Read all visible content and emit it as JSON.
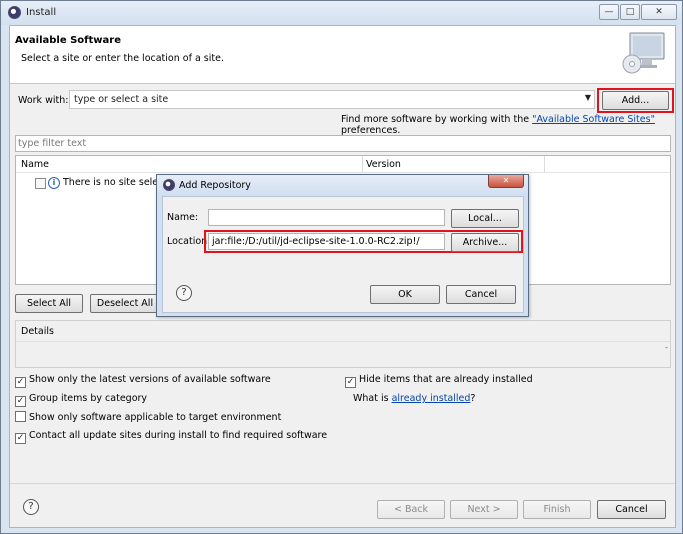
{
  "window": {
    "title": "Install",
    "min_glyph": "—",
    "max_glyph": "□",
    "close_glyph": "✕"
  },
  "header": {
    "title": "Available Software",
    "description": "Select a site or enter the location of a site."
  },
  "work_with": {
    "label": "Work with:",
    "placeholder": "type or select a site",
    "add_button": "Add..."
  },
  "find_more": {
    "prefix": "Find more software by working with the ",
    "link": "\"Available Software Sites\"",
    "suffix": " preferences."
  },
  "filter": {
    "placeholder": "type filter text"
  },
  "table": {
    "columns": [
      "Name",
      "Version"
    ],
    "rows": [
      {
        "text": "There is no site selected."
      }
    ]
  },
  "selection": {
    "select_all": "Select All",
    "deselect_all": "Deselect All"
  },
  "details": {
    "label": "Details"
  },
  "options": {
    "latest_versions": {
      "label": "Show only the latest versions of available software",
      "checked": true
    },
    "group_by_category": {
      "label": "Group items by category",
      "checked": true
    },
    "target_env": {
      "label": "Show only software applicable to target environment",
      "checked": false
    },
    "contact_sites": {
      "label": "Contact all update sites during install to find required software",
      "checked": true
    },
    "hide_installed": {
      "label": "Hide items that are already installed",
      "checked": true
    },
    "what_is": {
      "prefix": "What is ",
      "link": "already installed",
      "suffix": "?"
    }
  },
  "footer": {
    "help": "?",
    "back": "< Back",
    "next": "Next >",
    "finish": "Finish",
    "cancel": "Cancel"
  },
  "add_repository": {
    "title": "Add Repository",
    "close_glyph": "✕",
    "name_label": "Name:",
    "name_value": "",
    "local_button": "Local...",
    "location_label": "Location:",
    "location_value": "jar:file:/D:/util/jd-eclipse-site-1.0.0-RC2.zip!/",
    "archive_button": "Archive...",
    "help": "?",
    "ok": "OK",
    "cancel": "Cancel"
  },
  "colors": {
    "highlight": "#e0141c",
    "link": "#0645ad"
  }
}
